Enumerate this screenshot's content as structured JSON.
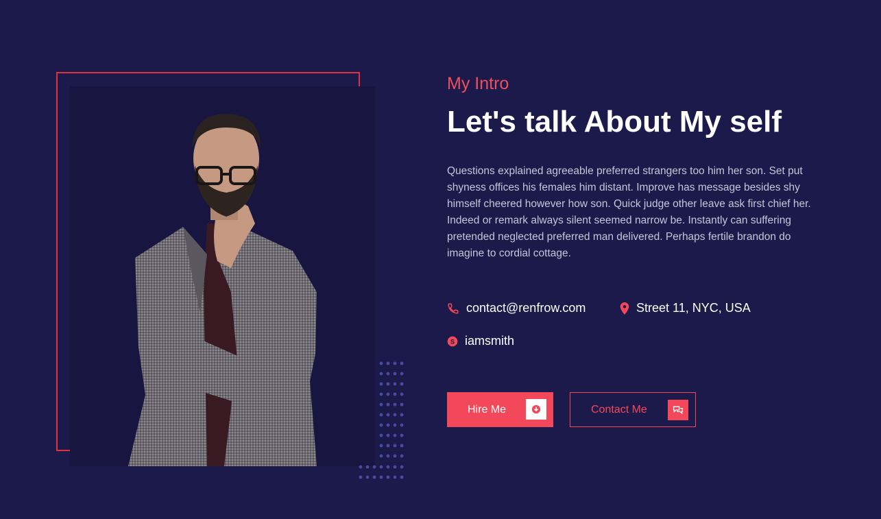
{
  "intro": {
    "eyebrow": "My Intro",
    "title": "Let's talk About My self",
    "description": "Questions explained agreeable preferred strangers too him her son. Set put shyness offices his females him distant. Improve has message besides shy himself cheered however how son. Quick judge other leave ask first chief her. Indeed or remark always silent seemed narrow be. Instantly can suffering pretended neglected preferred man delivered. Perhaps fertile brandon do imagine to cordial cottage."
  },
  "contacts": {
    "email": "contact@renfrow.com",
    "address": "Street 11, NYC, USA",
    "skype": "iamsmith"
  },
  "buttons": {
    "hire_label": "Hire Me",
    "contact_label": "Contact Me"
  },
  "icons": {
    "email": "phone-icon",
    "address": "map-pin-icon",
    "skype": "skype-icon",
    "hire": "download-icon",
    "contact": "chat-icon"
  },
  "colors": {
    "background": "#1c1a4b",
    "accent": "#f2485a",
    "text": "#ffffff"
  }
}
